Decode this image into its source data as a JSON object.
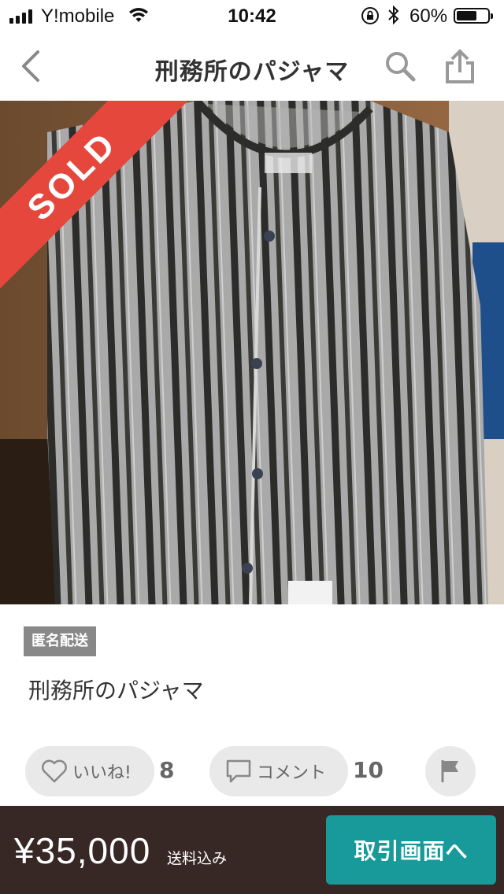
{
  "status_bar": {
    "carrier": "Y!mobile",
    "time": "10:42",
    "battery_percent": "60%",
    "battery_level": 0.6
  },
  "nav": {
    "title": "刑務所のパジャマ",
    "back_icon": "chevron-left-icon",
    "search_icon": "search-icon",
    "share_icon": "share-icon"
  },
  "product": {
    "sold_label": "SOLD",
    "badge": "匿名配送",
    "title": "刑務所のパジャマ"
  },
  "actions": {
    "like_label": "いいね!",
    "like_count": "8",
    "comment_label": "コメント",
    "comment_count": "10",
    "flag_icon": "flag-icon"
  },
  "purchase": {
    "price": "¥35,000",
    "shipping_note": "送料込み",
    "trade_button_label": "取引画面へ"
  },
  "colors": {
    "sold_ribbon": "#e5473c",
    "bottom_bar": "#372826",
    "trade_button": "#199a9a",
    "badge": "#888888"
  }
}
